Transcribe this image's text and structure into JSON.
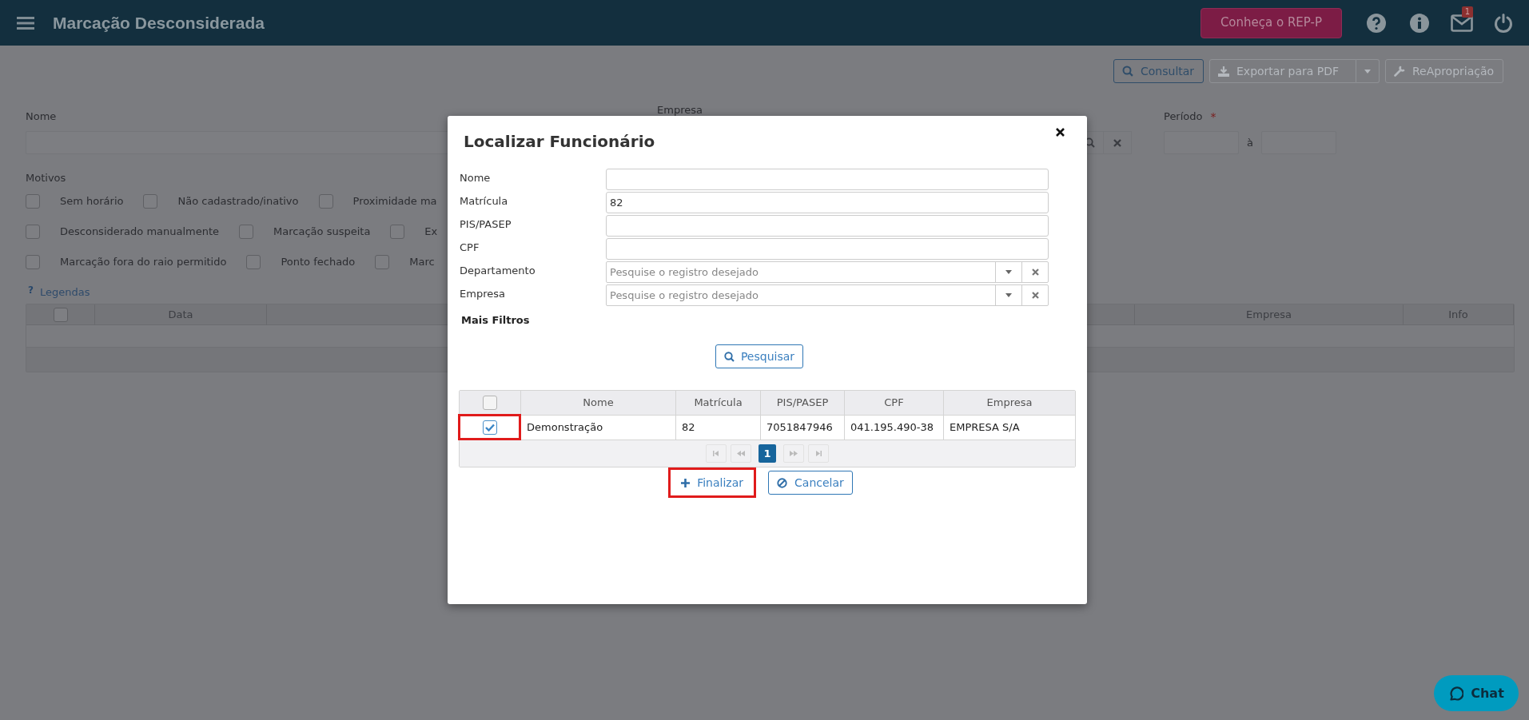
{
  "header": {
    "title": "Marcação Desconsiderada",
    "promo_button": "Conheça o REP-P",
    "notification_count": "1"
  },
  "toolbar": [
    {
      "label": "Consultar",
      "kind": "search",
      "disabled": false
    },
    {
      "label": "Exportar para PDF",
      "kind": "export",
      "disabled": true
    },
    {
      "label": "ReApropriação",
      "kind": "tool",
      "disabled": true
    }
  ],
  "filters": {
    "nome_label": "Nome",
    "empresa_label": "Empresa",
    "periodo_label": "Período",
    "required_mark": "*",
    "date_separator": "à",
    "motivos_label": "Motivos",
    "motivos": [
      [
        {
          "label": "Sem horário",
          "checked": false
        },
        {
          "label": "Não cadastrado/inativo",
          "checked": false
        },
        {
          "label": "Proximidade ma",
          "checked": false
        }
      ],
      [
        {
          "label": "Desconsiderado manualmente",
          "checked": false
        },
        {
          "label": "Marcação suspeita",
          "checked": false
        },
        {
          "label": "Ex",
          "checked": false
        }
      ],
      [
        {
          "label": "Marcação fora do raio permitido",
          "checked": false
        },
        {
          "label": "Ponto fechado",
          "checked": false
        },
        {
          "label": "Marc",
          "checked": false
        }
      ]
    ]
  },
  "legend": {
    "icon": "?",
    "label": "Legendas"
  },
  "table": {
    "columns": [
      {
        "kind": "select",
        "checked": false
      },
      {
        "kind": "text",
        "label": "Data"
      },
      {
        "kind": "text",
        "label": "Empresa"
      },
      {
        "kind": "text",
        "label": "Info"
      }
    ]
  },
  "dialog": {
    "title": "Localizar Funcionário",
    "fields": [
      {
        "label": "Nome",
        "kind": "text"
      },
      {
        "label": "Matrícula",
        "kind": "text",
        "value": "82"
      },
      {
        "label": "PIS/PASEP",
        "kind": "text"
      },
      {
        "label": "CPF",
        "kind": "text"
      },
      {
        "label": "Departamento",
        "kind": "lookup",
        "placeholder": "Pesquise o registro desejado"
      },
      {
        "label": "Empresa",
        "kind": "lookup",
        "placeholder": "Pesquise o registro desejado"
      }
    ],
    "more_filters": "Mais Filtros",
    "search_button": "Pesquisar",
    "results": {
      "select_all_checked": false,
      "columns": [
        "Nome",
        "Matrícula",
        "PIS/PASEP",
        "CPF",
        "Empresa"
      ],
      "rows": [
        {
          "checked": true,
          "highlighted": true,
          "cells": [
            "Demonstração",
            "82",
            "7051847946",
            "041.195.490-38",
            "EMPRESA S/A"
          ]
        }
      ],
      "pages": [
        {
          "label": "1",
          "selected": true
        }
      ]
    },
    "buttons": [
      {
        "label": "Finalizar",
        "kind": "add",
        "highlighted": true
      },
      {
        "label": "Cancelar",
        "kind": "cancel",
        "highlighted": false
      }
    ]
  },
  "chat_button": "Chat"
}
